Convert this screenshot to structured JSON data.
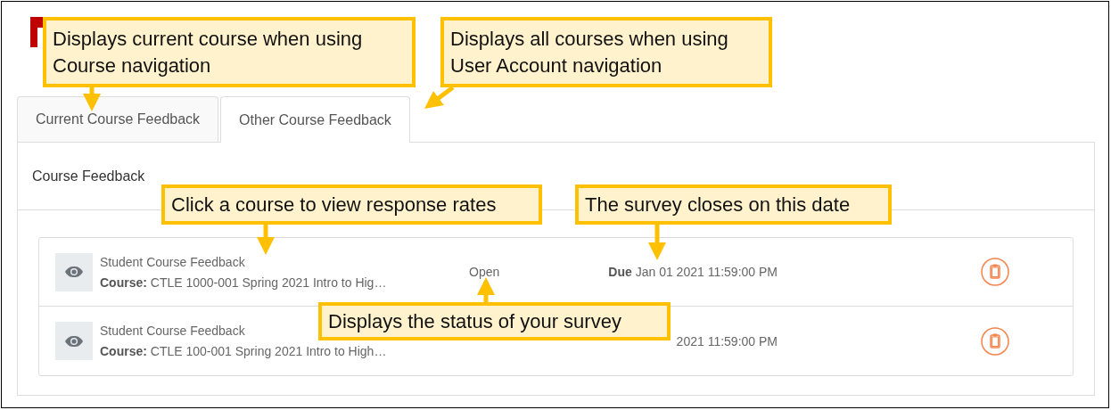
{
  "tabs": [
    {
      "label": "Current Course Feedback",
      "selected": false
    },
    {
      "label": "Other Course Feedback",
      "selected": true
    }
  ],
  "panel": {
    "title": "Course Feedback"
  },
  "surveys": [
    {
      "title": "Student Course Feedback",
      "course": "**Course:** CTLE 1000-001 Spring 2021 Intro to Hig…",
      "status": "Open",
      "due_label": "Due",
      "due": "Jan 01 2021 11:59:00 PM"
    },
    {
      "title": "Student Course Feedback",
      "course": "**Course:** CTLE 100-001 Spring 2021 Intro to High…",
      "due": "2021 11:59:00 PM"
    }
  ],
  "callouts": [
    "Displays current course when using Course navigation",
    "Displays all courses when using User Account navigation",
    "Click a course to view response rates",
    "The survey closes on this date",
    "Displays the status of your survey"
  ]
}
